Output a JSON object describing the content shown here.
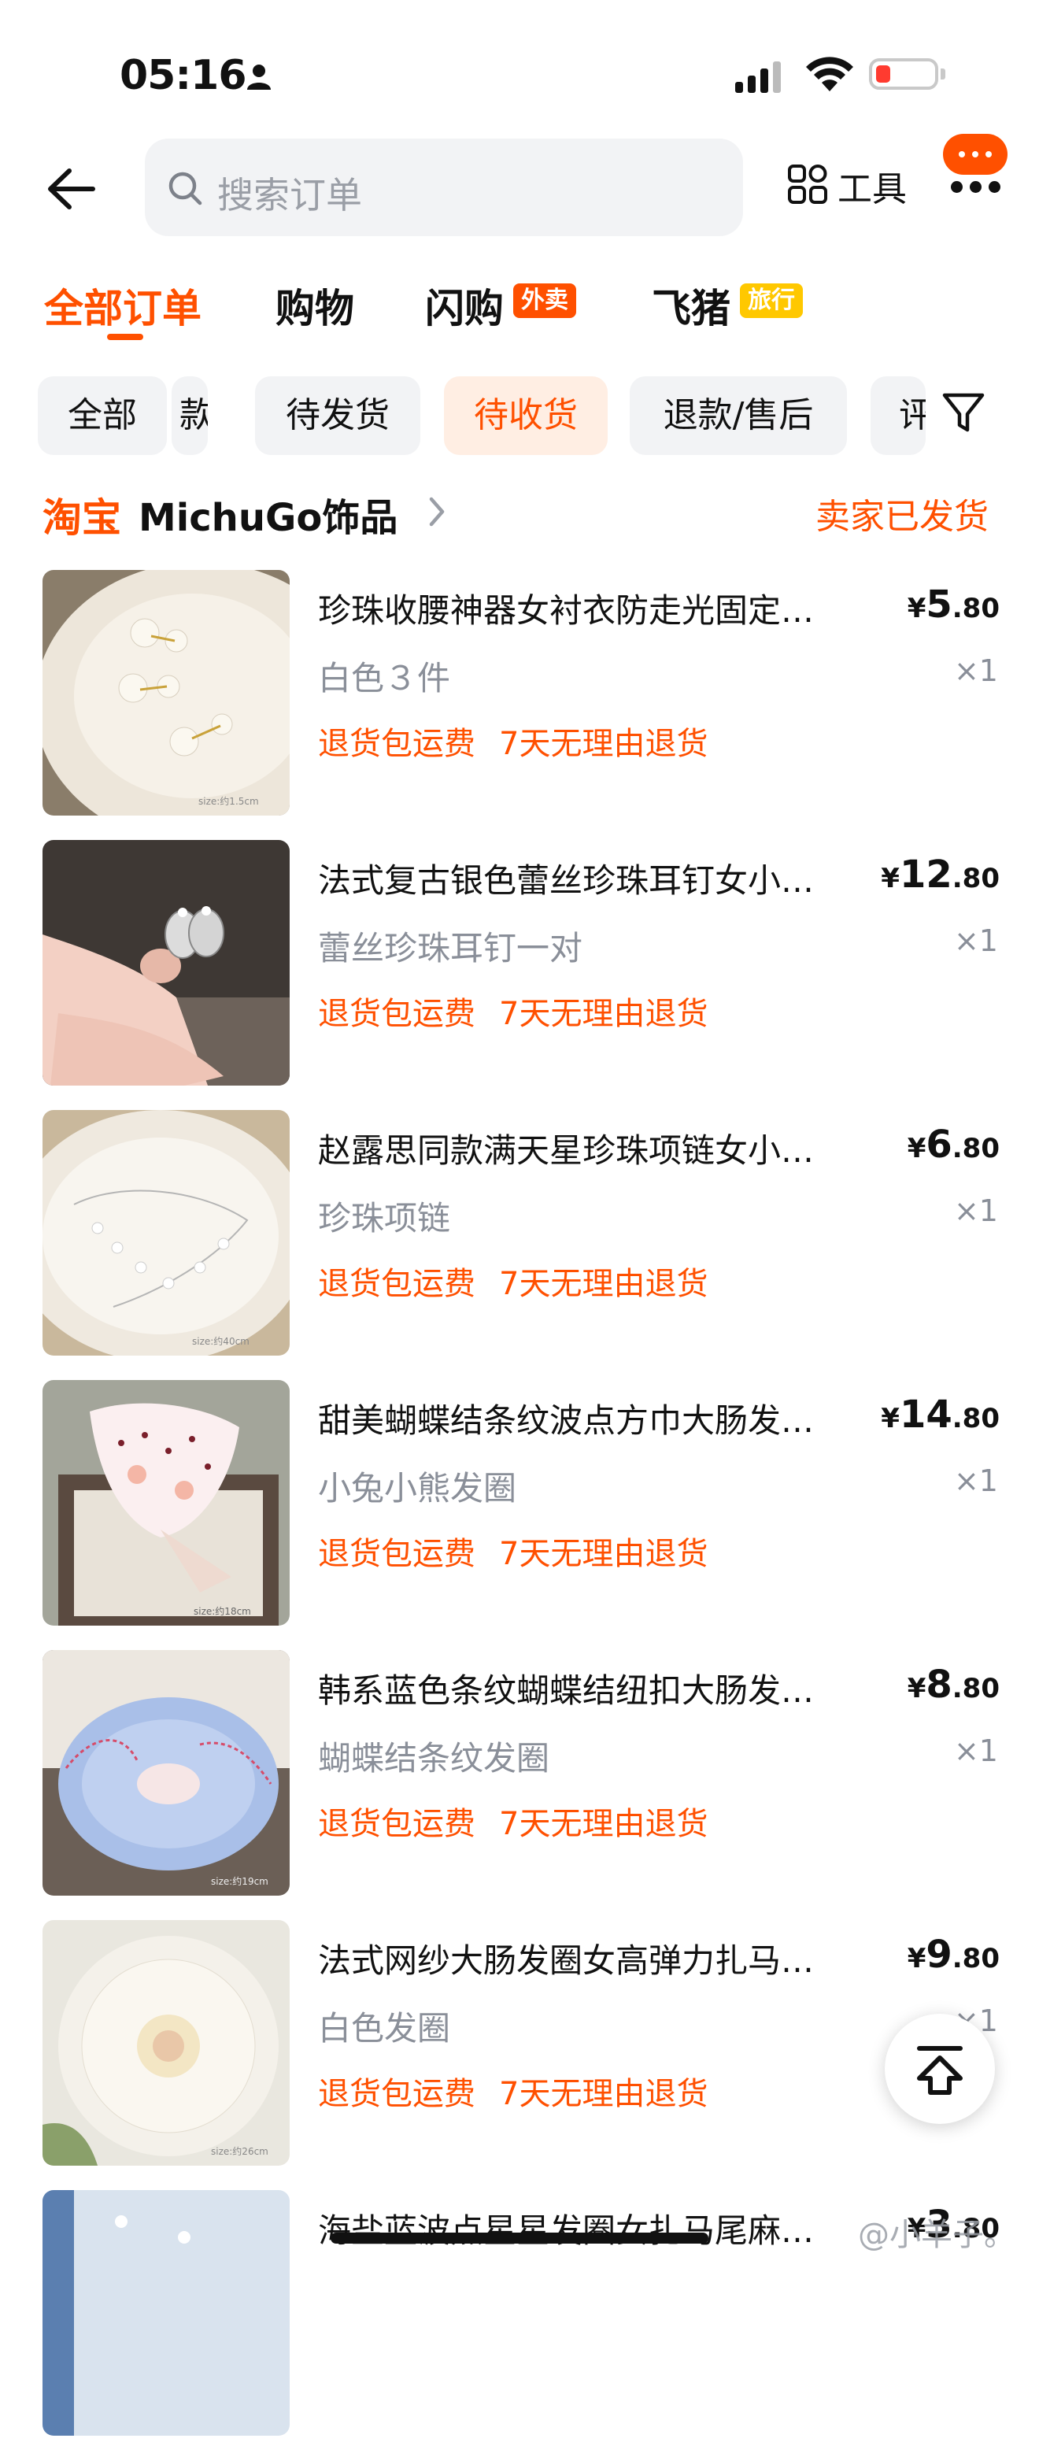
{
  "status_bar": {
    "time": "05:16"
  },
  "header": {
    "search_placeholder": "搜索订单",
    "tools_label": "工具"
  },
  "main_tabs": [
    {
      "label": "全部订单",
      "badge": "",
      "active": true
    },
    {
      "label": "购物",
      "badge": "",
      "active": false
    },
    {
      "label": "闪购",
      "badge": "外卖",
      "badge_color": "#ff5000",
      "active": false
    },
    {
      "label": "飞猪",
      "badge": "旅行",
      "badge_color": "#ffc800",
      "active": false
    }
  ],
  "filters": [
    {
      "label": "全部",
      "active": false
    },
    {
      "label": "款",
      "active": false
    },
    {
      "label": "待发货",
      "active": false
    },
    {
      "label": "待收货",
      "active": true
    },
    {
      "label": "退款/售后",
      "active": false
    },
    {
      "label": "评",
      "active": false
    }
  ],
  "shop": {
    "logo": "淘宝",
    "name": "MichuGo饰品",
    "status": "卖家已发货"
  },
  "items": [
    {
      "title": "珍珠收腰神器女衬衣防走光固定…",
      "price_int": "5",
      "price_dec": ".80",
      "spec": "白色３件",
      "qty": "×1",
      "tags": [
        "退货包运费",
        "7天无理由退货"
      ],
      "size_label": "size:约1.5cm"
    },
    {
      "title": "法式复古银色蕾丝珍珠耳钉女小…",
      "price_int": "12",
      "price_dec": ".80",
      "spec": "蕾丝珍珠耳钉一对",
      "qty": "×1",
      "tags": [
        "退货包运费",
        "7天无理由退货"
      ],
      "size_label": ""
    },
    {
      "title": "赵露思同款满天星珍珠项链女小…",
      "price_int": "6",
      "price_dec": ".80",
      "spec": "珍珠项链",
      "qty": "×1",
      "tags": [
        "退货包运费",
        "7天无理由退货"
      ],
      "size_label": "size:约40cm"
    },
    {
      "title": "甜美蝴蝶结条纹波点方巾大肠发…",
      "price_int": "14",
      "price_dec": ".80",
      "spec": "小兔小熊发圈",
      "qty": "×1",
      "tags": [
        "退货包运费",
        "7天无理由退货"
      ],
      "size_label": "size:约18cm"
    },
    {
      "title": "韩系蓝色条纹蝴蝶结纽扣大肠发…",
      "price_int": "8",
      "price_dec": ".80",
      "spec": "蝴蝶结条纹发圈",
      "qty": "×1",
      "tags": [
        "退货包运费",
        "7天无理由退货"
      ],
      "size_label": "size:约19cm"
    },
    {
      "title": "法式网纱大肠发圈女高弹力扎马…",
      "price_int": "9",
      "price_dec": ".80",
      "spec": "白色发圈",
      "qty": "×1",
      "tags": [
        "退货包运费",
        "7天无理由退货"
      ],
      "size_label": "size:约26cm"
    },
    {
      "title": "海盐蓝波点星星发圈女扎马尾麻…",
      "price_int": "3",
      "price_dec": ".80",
      "spec": "",
      "qty": "",
      "tags": [],
      "size_label": ""
    }
  ],
  "currency": "¥",
  "watermark": "@小羊子。",
  "colors": {
    "accent": "#ff5000",
    "chip_bg": "#f2f3f5",
    "chip_active_bg": "#ffeee3",
    "muted_text": "#8a8f99"
  }
}
